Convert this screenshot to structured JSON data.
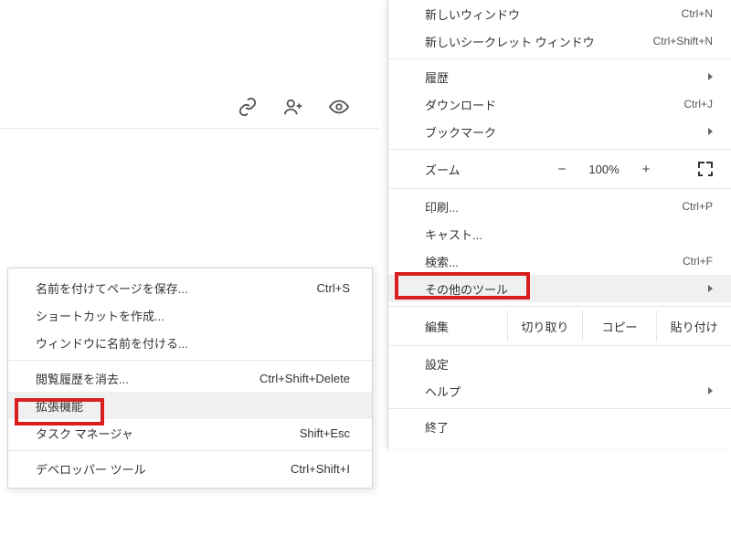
{
  "toolbar": {
    "icons": [
      "link",
      "add-person",
      "eye"
    ]
  },
  "mainMenu": {
    "newWindow": {
      "label": "新しいウィンドウ",
      "shortcut": "Ctrl+N"
    },
    "newIncognito": {
      "label": "新しいシークレット ウィンドウ",
      "shortcut": "Ctrl+Shift+N"
    },
    "history": {
      "label": "履歴"
    },
    "downloads": {
      "label": "ダウンロード",
      "shortcut": "Ctrl+J"
    },
    "bookmarks": {
      "label": "ブックマーク"
    },
    "zoom": {
      "label": "ズーム",
      "minus": "−",
      "value": "100%",
      "plus": "+"
    },
    "print": {
      "label": "印刷...",
      "shortcut": "Ctrl+P"
    },
    "cast": {
      "label": "キャスト..."
    },
    "find": {
      "label": "検索...",
      "shortcut": "Ctrl+F"
    },
    "otherTools": {
      "label": "その他のツール"
    },
    "edit": {
      "label": "編集",
      "cut": "切り取り",
      "copy": "コピー",
      "paste": "貼り付け"
    },
    "settings": {
      "label": "設定"
    },
    "help": {
      "label": "ヘルプ"
    },
    "exit": {
      "label": "終了"
    }
  },
  "subMenu": {
    "savePage": {
      "label": "名前を付けてページを保存...",
      "shortcut": "Ctrl+S"
    },
    "createShortcut": {
      "label": "ショートカットを作成..."
    },
    "nameWindow": {
      "label": "ウィンドウに名前を付ける..."
    },
    "clearBrowsing": {
      "label": "閲覧履歴を消去...",
      "shortcut": "Ctrl+Shift+Delete"
    },
    "extensions": {
      "label": "拡張機能"
    },
    "taskManager": {
      "label": "タスク マネージャ",
      "shortcut": "Shift+Esc"
    },
    "devTools": {
      "label": "デベロッパー ツール",
      "shortcut": "Ctrl+Shift+I"
    }
  }
}
